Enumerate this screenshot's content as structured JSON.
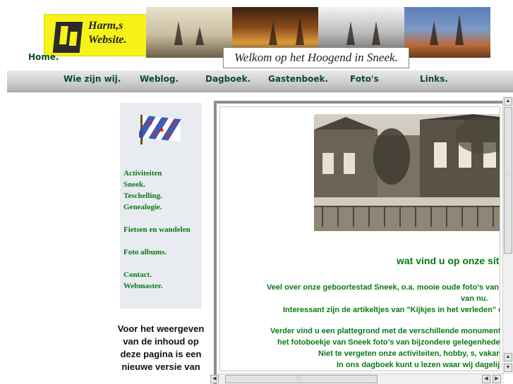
{
  "header": {
    "logo_text_line1": "Harm,s",
    "logo_text_line2": "Website.",
    "home_label": "Home.",
    "caption": "Welkom op het Hoogend in Sneek."
  },
  "nav": {
    "items": [
      "Wie zijn wij.",
      "Weblog.",
      "Dagboek.",
      "Gastenboek.",
      "Foto's",
      "Links."
    ]
  },
  "sidebar": {
    "menu": [
      "Activiteiten",
      "Sneek.",
      "Teschelling.",
      "Genealogie.",
      "Fietsen en wandelen",
      "Foto albums.",
      "Contact.",
      "Webmaster."
    ],
    "intro": "Voor het weergeven van de inhoud op deze pagina is een nieuwe versie van"
  },
  "content": {
    "title": "wat vind u op onze site",
    "lines": [
      "Veel over onze geboortestad Sneek, o.a. mooie oude foto's van ho",
      "van nu.",
      "Interessant zijn de artikeltjes van \"Kijkjes in het verleden\" dit",
      "Verder vind u een plattegrond met de verschillende monumenter",
      "het fotoboekje van Sneek foto's van bijzondere gelegenheden i",
      "Niet te vergeten onze activiteiten, hobby, s, vakantie",
      "In ons dagboek kunt u lezen waar wij dagelijks"
    ]
  },
  "colors": {
    "link_green": "#0a7a16",
    "nav_text": "#0d4a2a",
    "logo_yellow": "#f6f21a",
    "sidebar_bg": "#e8ebf0"
  },
  "icons": {
    "flag": "frisian-flag-icon",
    "scroll_up": "arrow-up-icon",
    "scroll_down": "arrow-down-icon",
    "scroll_left": "arrow-left-icon",
    "scroll_right": "arrow-right-icon"
  }
}
